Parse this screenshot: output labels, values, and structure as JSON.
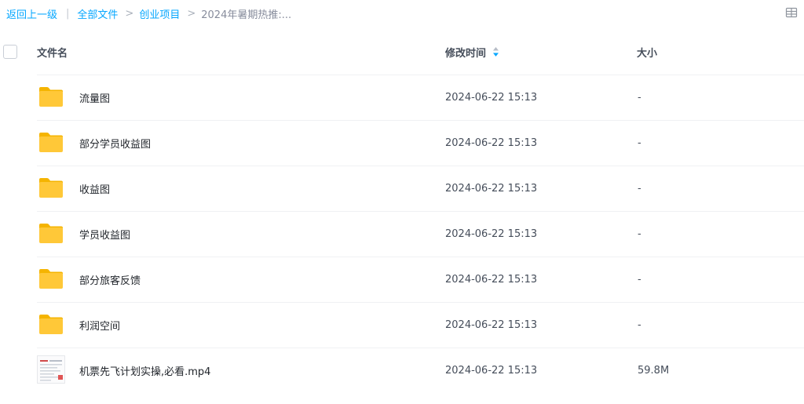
{
  "breadcrumb": {
    "back": "返回上一级",
    "divider": "|",
    "items": [
      "全部文件",
      "创业项目"
    ],
    "separator": ">",
    "current": "2024年暑期热推:..."
  },
  "header": {
    "name": "文件名",
    "time": "修改时间",
    "size": "大小"
  },
  "colors": {
    "link": "#06a7ff",
    "folder": "#ffc838",
    "sort_active": "#06a7ff"
  },
  "files": [
    {
      "name": "流量图",
      "time": "2024-06-22 15:13",
      "size": "-",
      "icon": "folder-icon"
    },
    {
      "name": "部分学员收益图",
      "time": "2024-06-22 15:13",
      "size": "-",
      "icon": "folder-icon"
    },
    {
      "name": "收益图",
      "time": "2024-06-22 15:13",
      "size": "-",
      "icon": "folder-icon"
    },
    {
      "name": "学员收益图",
      "time": "2024-06-22 15:13",
      "size": "-",
      "icon": "folder-icon"
    },
    {
      "name": "部分旅客反馈",
      "time": "2024-06-22 15:13",
      "size": "-",
      "icon": "folder-icon"
    },
    {
      "name": "利润空间",
      "time": "2024-06-22 15:13",
      "size": "-",
      "icon": "folder-icon"
    },
    {
      "name": "机票先飞计划实操,必看.mp4",
      "time": "2024-06-22 15:13",
      "size": "59.8M",
      "icon": "video-thumbnail"
    }
  ]
}
